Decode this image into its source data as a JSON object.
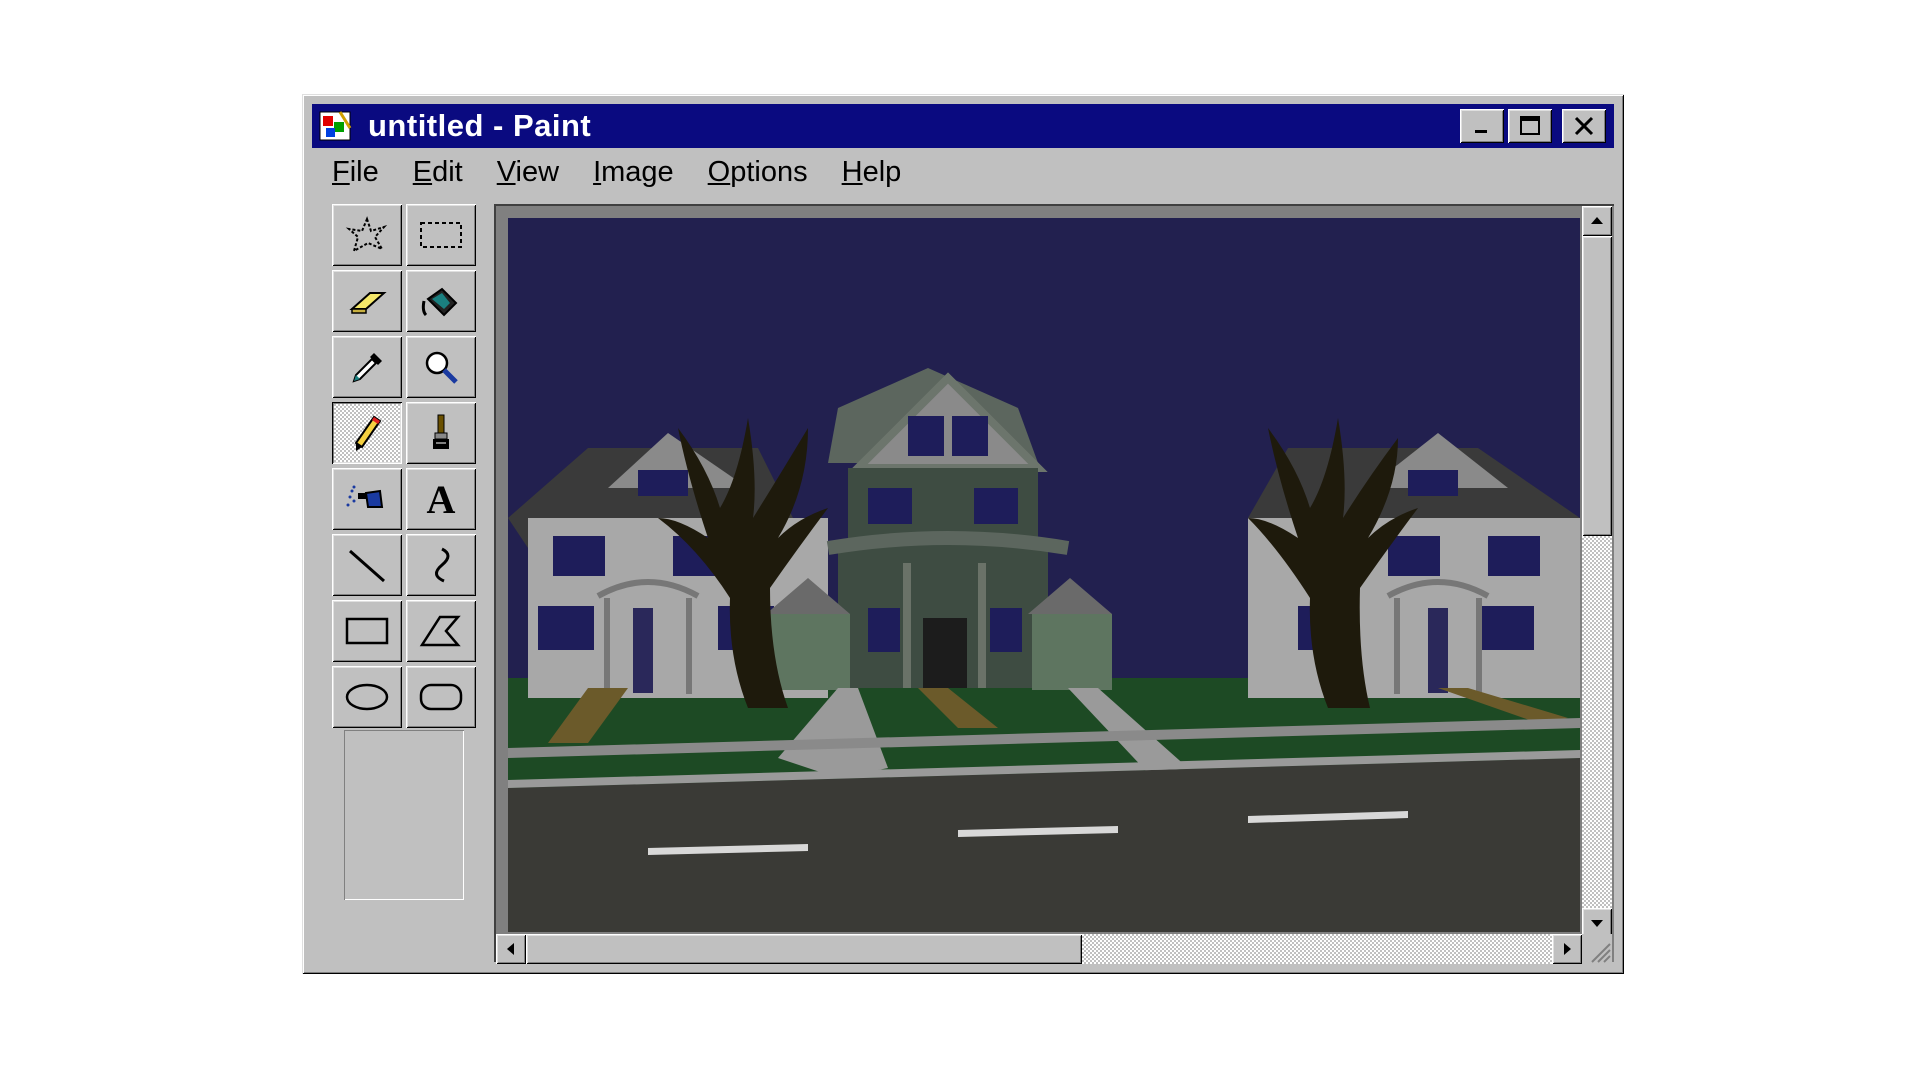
{
  "window": {
    "title": "untitled - Paint",
    "controls": [
      "minimize",
      "maximize",
      "close"
    ]
  },
  "menu": [
    {
      "accel": "F",
      "rest": "ile"
    },
    {
      "accel": "E",
      "rest": "dit"
    },
    {
      "accel": "V",
      "rest": "iew"
    },
    {
      "accel": "I",
      "rest": "mage"
    },
    {
      "accel": "O",
      "rest": "ptions"
    },
    {
      "accel": "H",
      "rest": "elp"
    }
  ],
  "tools": [
    {
      "name": "free-form-select",
      "icon": "star-select-icon"
    },
    {
      "name": "select",
      "icon": "rect-select-icon"
    },
    {
      "name": "eraser",
      "icon": "eraser-icon"
    },
    {
      "name": "fill-with-color",
      "icon": "paint-bucket-icon"
    },
    {
      "name": "pick-color",
      "icon": "eyedropper-icon"
    },
    {
      "name": "magnifier",
      "icon": "magnifier-icon"
    },
    {
      "name": "pencil",
      "icon": "pencil-icon",
      "active": true
    },
    {
      "name": "brush",
      "icon": "brush-icon"
    },
    {
      "name": "airbrush",
      "icon": "airbrush-icon"
    },
    {
      "name": "text",
      "icon": "text-icon"
    },
    {
      "name": "line",
      "icon": "line-icon"
    },
    {
      "name": "curve",
      "icon": "curve-icon"
    },
    {
      "name": "rectangle",
      "icon": "rectangle-icon"
    },
    {
      "name": "polygon",
      "icon": "polygon-icon"
    },
    {
      "name": "ellipse",
      "icon": "ellipse-icon"
    },
    {
      "name": "rounded-rectangle",
      "icon": "rounded-rectangle-icon"
    }
  ],
  "tools_text_glyph": "A",
  "canvas": {
    "description_colors": {
      "sky": "#22204f",
      "road": "#3a3a36",
      "grass": "#1d4a24"
    }
  },
  "colors": {
    "titlebar": "#0a0a80",
    "face": "#c0c0c0"
  }
}
